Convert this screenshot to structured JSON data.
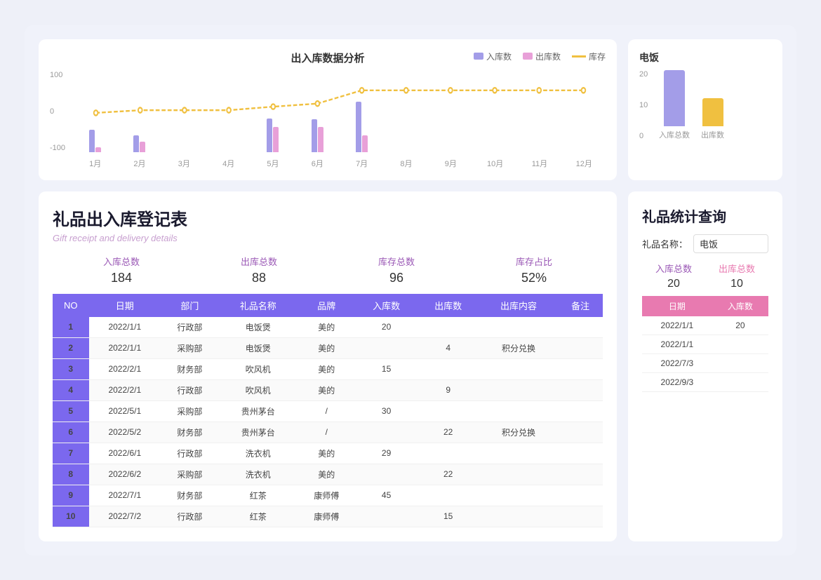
{
  "topChart": {
    "title": "出入库数据分析",
    "legend": {
      "in": "入库数",
      "out": "出库数",
      "stock": "库存"
    },
    "months": [
      "1月",
      "2月",
      "3月",
      "4月",
      "5月",
      "6月",
      "7月",
      "8月",
      "9月",
      "10月",
      "11月",
      "12月"
    ],
    "yLabels": [
      "100",
      "0",
      "-100"
    ],
    "inData": [
      20,
      15,
      0,
      0,
      30,
      29,
      45,
      0,
      0,
      0,
      0,
      0
    ],
    "outData": [
      4,
      9,
      0,
      0,
      22,
      22,
      15,
      0,
      0,
      0,
      0,
      0
    ],
    "stockLine": [
      16,
      22,
      22,
      22,
      30,
      37,
      67,
      67,
      67,
      67,
      67,
      67
    ]
  },
  "smallChart": {
    "title": "电饭",
    "yLabels": [
      "20",
      "10",
      "0"
    ],
    "bars": [
      {
        "label": "入库总数",
        "value": 20,
        "color": "#a39de8"
      },
      {
        "label": "出库数",
        "value": 10,
        "color": "#f0c040"
      }
    ]
  },
  "tableSection": {
    "title": "礼品出入库登记表",
    "subtitle": "Gift receipt and delivery details",
    "stats": [
      {
        "label": "入库总数",
        "value": "184"
      },
      {
        "label": "出库总数",
        "value": "88"
      },
      {
        "label": "库存总数",
        "value": "96"
      },
      {
        "label": "库存占比",
        "value": "52%"
      }
    ],
    "columns": [
      "NO",
      "日期",
      "部门",
      "礼品名称",
      "品牌",
      "入库数",
      "出库数",
      "出库内容",
      "备注"
    ],
    "rows": [
      [
        "1",
        "2022/1/1",
        "行政部",
        "电饭煲",
        "美的",
        "20",
        "",
        "",
        ""
      ],
      [
        "2",
        "2022/1/1",
        "采购部",
        "电饭煲",
        "美的",
        "",
        "4",
        "积分兑换",
        ""
      ],
      [
        "3",
        "2022/2/1",
        "财务部",
        "吹风机",
        "美的",
        "15",
        "",
        "",
        ""
      ],
      [
        "4",
        "2022/2/1",
        "行政部",
        "吹风机",
        "美的",
        "",
        "9",
        "",
        ""
      ],
      [
        "5",
        "2022/5/1",
        "采购部",
        "贵州茅台",
        "/",
        "30",
        "",
        "",
        ""
      ],
      [
        "6",
        "2022/5/2",
        "财务部",
        "贵州茅台",
        "/",
        "",
        "22",
        "积分兑换",
        ""
      ],
      [
        "7",
        "2022/6/1",
        "行政部",
        "洗衣机",
        "美的",
        "29",
        "",
        "",
        ""
      ],
      [
        "8",
        "2022/6/2",
        "采购部",
        "洗衣机",
        "美的",
        "",
        "22",
        "",
        ""
      ],
      [
        "9",
        "2022/7/1",
        "财务部",
        "红茶",
        "康师傅",
        "45",
        "",
        "",
        ""
      ],
      [
        "10",
        "2022/7/2",
        "行政部",
        "红茶",
        "康师傅",
        "",
        "15",
        "",
        ""
      ]
    ]
  },
  "statsSection": {
    "title": "礼品统计查询",
    "searchLabel": "礼品名称：",
    "searchValue": "电饭",
    "inLabel": "入库总数",
    "outLabel": "出库总数",
    "inValue": "20",
    "outValue": "10",
    "miniColumns": [
      "日期",
      "入库数"
    ],
    "miniRows": [
      [
        "2022/1/1",
        "20"
      ],
      [
        "2022/1/1",
        ""
      ],
      [
        "2022/7/3",
        ""
      ],
      [
        "2022/9/3",
        ""
      ]
    ]
  }
}
